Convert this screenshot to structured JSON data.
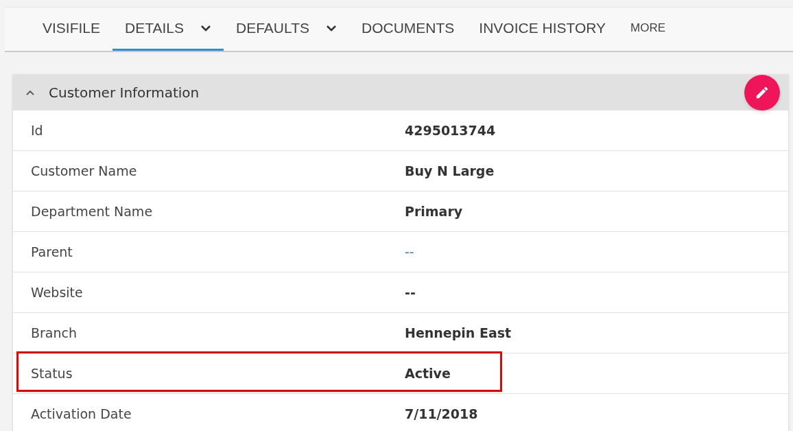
{
  "tabs": [
    {
      "label": "VISIFILE",
      "kind": "plain",
      "selected": false
    },
    {
      "label": "DETAILS",
      "kind": "dropdown",
      "selected": true
    },
    {
      "label": "DEFAULTS",
      "kind": "dropdown",
      "selected": false
    },
    {
      "label": "DOCUMENTS",
      "kind": "plain",
      "selected": false
    },
    {
      "label": "INVOICE HISTORY",
      "kind": "plain",
      "selected": false
    },
    {
      "label": "MORE",
      "kind": "more",
      "selected": false
    }
  ],
  "panel": {
    "title": "Customer Information",
    "expanded": true,
    "rows": [
      {
        "label": "Id",
        "value": "4295013744",
        "kind": "text",
        "highlighted": false
      },
      {
        "label": "Customer Name",
        "value": "Buy N Large",
        "kind": "text",
        "highlighted": false
      },
      {
        "label": "Department Name",
        "value": "Primary",
        "kind": "text",
        "highlighted": false
      },
      {
        "label": "Parent",
        "value": "--",
        "kind": "link",
        "highlighted": false
      },
      {
        "label": "Website",
        "value": "--",
        "kind": "text",
        "highlighted": false
      },
      {
        "label": "Branch",
        "value": "Hennepin East",
        "kind": "text",
        "highlighted": false
      },
      {
        "label": "Status",
        "value": "Active",
        "kind": "text",
        "highlighted": true
      },
      {
        "label": "Activation Date",
        "value": "7/11/2018",
        "kind": "text",
        "highlighted": false
      }
    ]
  }
}
